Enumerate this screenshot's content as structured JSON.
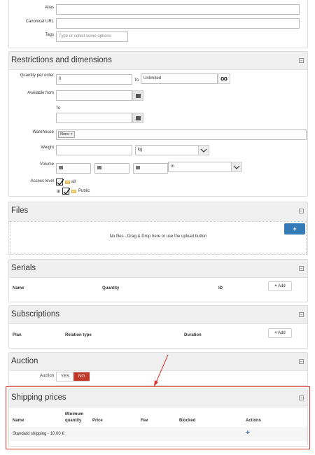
{
  "fields": {
    "alias_label": "Alias",
    "canonical_label": "Canonical URL",
    "tags_label": "Tags",
    "tags_placeholder": "Type or select some options"
  },
  "restrictions": {
    "title": "Restrictions and dimensions",
    "qty_label": "Quantity per order",
    "qty_min": "0",
    "to": "To",
    "qty_max": "Unlimited",
    "available_label": "Available from",
    "to2": "To",
    "warehouse_label": "Warehouse",
    "warehouse_tag": "None",
    "weight_label": "Weight",
    "weight_unit": "kg",
    "volume_label": "Volume",
    "volume_unit": "m",
    "access_label": "Access level",
    "access_all": "all",
    "access_public": "Public"
  },
  "files": {
    "title": "Files",
    "dropzone_text": "No files - Drag & Drop here or use the upload button",
    "upload_label": "+"
  },
  "serials": {
    "title": "Serials",
    "columns": [
      "Name",
      "Quantity",
      "ID"
    ],
    "add_label": "Add"
  },
  "subscriptions": {
    "title": "Subscriptions",
    "columns": [
      "Plan",
      "Relation type",
      "Duration"
    ],
    "add_label": "Add"
  },
  "auction": {
    "title": "Auction",
    "label": "Auction",
    "yes": "YES",
    "no": "NO"
  },
  "shipping": {
    "title": "Shipping prices",
    "columns": [
      "Name",
      "Minimum quantity",
      "Price",
      "Fee",
      "Blocked",
      "Actions"
    ],
    "row_name": "Standard shipping - 10,00 €",
    "row_action": "+"
  },
  "colors": {
    "panel_header": "#efefef",
    "no_toggle": "#c0392b",
    "primary_button": "#337ab7",
    "highlight_border": "#d9302a",
    "arrow": "#d9302a"
  }
}
